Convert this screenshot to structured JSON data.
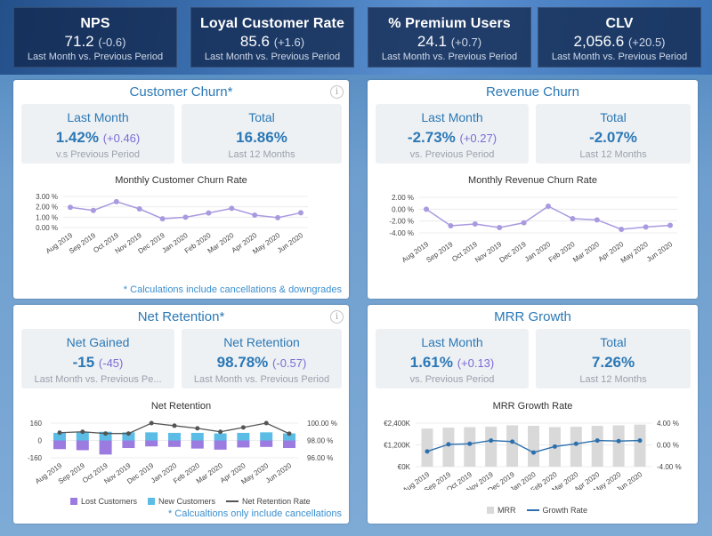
{
  "kpis": [
    {
      "title": "NPS",
      "value": "71.2",
      "delta": "(-0.6)",
      "sub": "Last Month vs. Previous Period"
    },
    {
      "title": "Loyal Customer Rate",
      "value": "85.6",
      "delta": "(+1.6)",
      "sub": "Last Month vs. Previous Period"
    },
    {
      "title": "% Premium Users",
      "value": "24.1",
      "delta": "(+0.7)",
      "sub": "Last Month vs. Previous Period"
    },
    {
      "title": "CLV",
      "value": "2,056.6",
      "delta": "(+20.5)",
      "sub": "Last Month vs. Previous Period"
    }
  ],
  "panels": {
    "customer_churn": {
      "title": "Customer Churn*",
      "left": {
        "label": "Last Month",
        "value": "1.42%",
        "delta": "(+0.46)",
        "sub": "v.s Previous Period"
      },
      "right": {
        "label": "Total",
        "value": "16.86%",
        "sub": "Last 12 Months"
      },
      "note": "* Calculations include cancellations & downgrades"
    },
    "revenue_churn": {
      "title": "Revenue Churn",
      "left": {
        "label": "Last Month",
        "value": "-2.73%",
        "delta": "(+0.27)",
        "sub": "vs. Previous Period"
      },
      "right": {
        "label": "Total",
        "value": "-2.07%",
        "sub": "Last 12 Months"
      }
    },
    "net_retention": {
      "title": "Net Retention*",
      "left": {
        "label": "Net Gained",
        "value": "-15",
        "delta": "(-45)",
        "sub": "Last Month vs. Previous Pe..."
      },
      "right": {
        "label": "Net Retention",
        "value": "98.78%",
        "delta": "(-0.57)",
        "sub": "Last Month vs. Previous Period"
      },
      "note": "* Calcualtions only include cancellations"
    },
    "mrr_growth": {
      "title": "MRR Growth",
      "left": {
        "label": "Last Month",
        "value": "1.61%",
        "delta": "(+0.13)",
        "sub": "vs. Previous Period"
      },
      "right": {
        "label": "Total",
        "value": "7.26%",
        "sub": "Last 12 Months"
      }
    }
  },
  "colors": {
    "accent": "#2b78b5",
    "delta": "#7b6ad6",
    "line": "#a99ae0",
    "lost": "#9b7be0",
    "new": "#5bbde6",
    "net_line": "#555555",
    "mrr_bar": "#d9d9d9",
    "growth_line": "#2b6fae"
  },
  "chart_data": [
    {
      "type": "line",
      "title": "Monthly Customer Churn Rate",
      "categories": [
        "Aug 2019",
        "Sep 2019",
        "Oct 2019",
        "Nov 2019",
        "Dec 2019",
        "Jan 2020",
        "Feb 2020",
        "Mar 2020",
        "Apr 2020",
        "May 2020",
        "Jun 2020"
      ],
      "values": [
        1.95,
        1.65,
        2.5,
        1.8,
        0.85,
        1.0,
        1.4,
        1.85,
        1.2,
        0.95,
        1.42
      ],
      "ylim": [
        0,
        3
      ],
      "yticks": [
        "3.00 %",
        "2.00 %",
        "1.00 %",
        "0.00 %"
      ],
      "ytick_values": [
        3,
        2,
        1,
        0
      ]
    },
    {
      "type": "line",
      "title": "Monthly Revenue Churn Rate",
      "categories": [
        "Aug 2019",
        "Sep 2019",
        "Oct 2019",
        "Nov 2019",
        "Dec 2019",
        "Jan 2020",
        "Feb 2020",
        "Mar 2020",
        "Apr 2020",
        "May 2020",
        "Jun 2020"
      ],
      "values": [
        0.0,
        -2.8,
        -2.5,
        -3.1,
        -2.3,
        0.5,
        -1.6,
        -1.8,
        -3.4,
        -3.0,
        -2.73
      ],
      "ylim": [
        -4,
        2
      ],
      "yticks": [
        "2.00 %",
        "0.00 %",
        "-2.00 %",
        "-4.00 %"
      ],
      "ytick_values": [
        2,
        0,
        -2,
        -4
      ]
    },
    {
      "type": "bar",
      "title": "Net Retention",
      "categories": [
        "Aug 2019",
        "Sep 2019",
        "Oct 2019",
        "Nov 2019",
        "Dec 2019",
        "Jan 2020",
        "Feb 2020",
        "Mar 2020",
        "Apr 2020",
        "May 2020",
        "Jun 2020"
      ],
      "series": [
        {
          "name": "Lost Customers",
          "values": [
            -80,
            -90,
            -130,
            -70,
            -55,
            -60,
            -75,
            -85,
            -65,
            -60,
            -70
          ]
        },
        {
          "name": "New Customers",
          "values": [
            70,
            80,
            80,
            75,
            75,
            70,
            70,
            65,
            70,
            75,
            65
          ]
        },
        {
          "name": "Net Retention Rate",
          "values": [
            98.9,
            99.0,
            98.8,
            98.8,
            100.0,
            99.7,
            99.4,
            99.0,
            99.5,
            100.0,
            98.78
          ]
        }
      ],
      "ylim_left": [
        -160,
        160
      ],
      "yticks_left": [
        "160",
        "0",
        "-160"
      ],
      "ytick_values_left": [
        160,
        0,
        -160
      ],
      "ylim_right": [
        96,
        100
      ],
      "yticks_right": [
        "100.00 %",
        "98.00 %",
        "96.00 %"
      ],
      "ytick_values_right": [
        100,
        98,
        96
      ]
    },
    {
      "type": "bar",
      "title": "MRR Growth Rate",
      "categories": [
        "Aug 2019",
        "Sep 2019",
        "Oct 2019",
        "Nov 2019",
        "Dec 2019",
        "Jan 2020",
        "Feb 2020",
        "Mar 2020",
        "Apr 2020",
        "May 2020",
        "Jun 2020"
      ],
      "series": [
        {
          "name": "MRR",
          "values": [
            2100,
            2150,
            2180,
            2200,
            2280,
            2250,
            2180,
            2200,
            2250,
            2280,
            2320
          ]
        },
        {
          "name": "Growth Rate",
          "values": [
            -1.2,
            0.1,
            0.2,
            0.8,
            0.6,
            -1.4,
            -0.3,
            0.2,
            0.8,
            0.7,
            0.8
          ]
        }
      ],
      "ylim_left": [
        0,
        2400
      ],
      "yticks_left": [
        "€2,400K",
        "€1,200K",
        "€0K"
      ],
      "ytick_values_left": [
        2400,
        1200,
        0
      ],
      "ylim_right": [
        -4,
        4
      ],
      "yticks_right": [
        "4.00 %",
        "0.00 %",
        "-4.00 %"
      ],
      "ytick_values_right": [
        4,
        0,
        -4
      ]
    }
  ]
}
